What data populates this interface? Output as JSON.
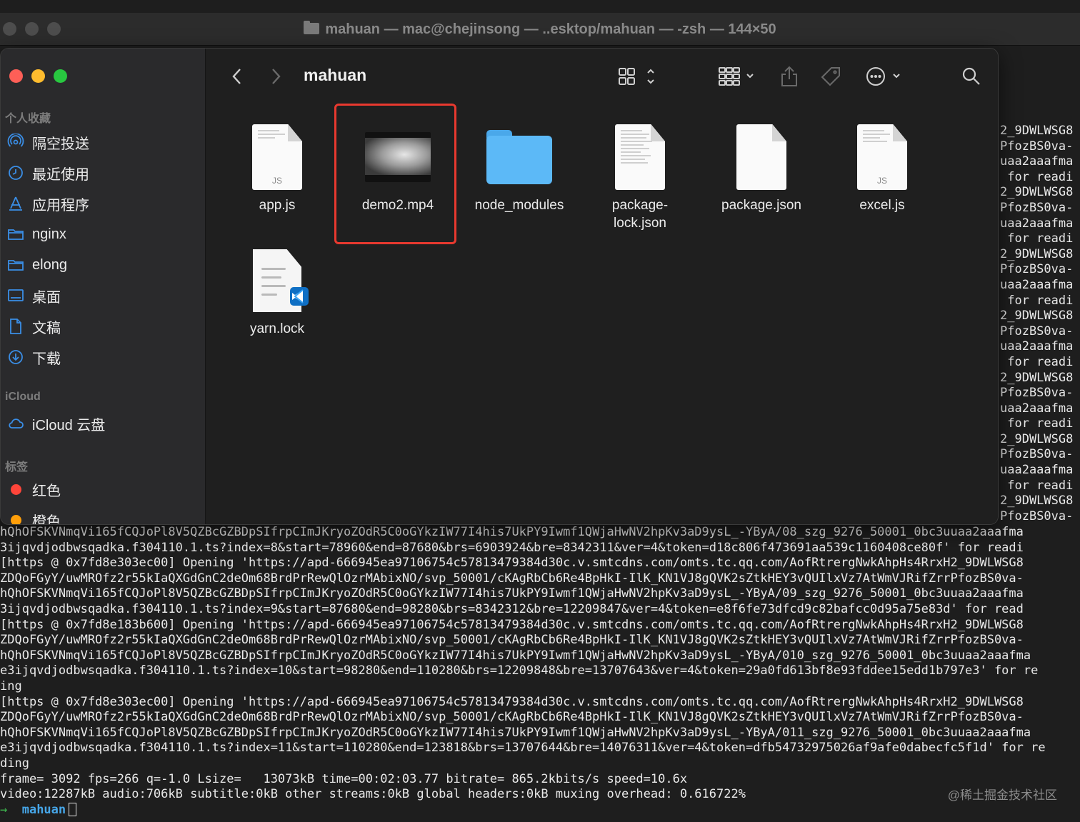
{
  "terminal": {
    "title_parts": "mahuan — mac@chejinsong — ..esktop/mahuan — -zsh — 144×50",
    "right_column": [
      "2_9DWLWSG8",
      "PfozBS0va-",
      "uaa2aaafma",
      " for readi",
      "2_9DWLWSG8",
      "PfozBS0va-",
      "uaa2aaafma",
      " for readi",
      "2_9DWLWSG8",
      "PfozBS0va-",
      "uaa2aaafma",
      " for readi",
      "2_9DWLWSG8",
      "PfozBS0va-",
      "uaa2aaafma",
      " for readi",
      "2_9DWLWSG8",
      "PfozBS0va-",
      "uaa2aaafma",
      " for readi",
      "2_9DWLWSG8",
      "PfozBS0va-",
      "uaa2aaafma",
      " for readi",
      "2_9DWLWSG8",
      "PfozBS0va-"
    ],
    "lines": [
      "hQhOFSKVNmqVi165fCQJoPl8V5QZBcGZBDpSIfrpCImJKryoZOdR5C0oGYkzIW77I4his7UkPY9Iwmf1QWjaHwNV2hpKv3aD9ysL_-YByA/08_szg_9276_50001_0bc3uuaa2aaafma",
      "3ijqvdjodbwsqadka.f304110.1.ts?index=8&start=78960&end=87680&brs=6903924&bre=8342311&ver=4&token=d18c806f473691aa539c1160408ce80f' for readi",
      "[https @ 0x7fd8e303ec00] Opening 'https://apd-666945ea97106754c57813479384d30c.v.smtcdns.com/omts.tc.qq.com/AofRtrergNwkAhpHs4RrxH2_9DWLWSG8",
      "ZDQoFGyY/uwMROfz2r55kIaQXGdGnC2deOm68BrdPrRewQlOzrMAbixNO/svp_50001/cKAgRbCb6Re4BpHkI-IlK_KN1VJ8gQVK2sZtkHEY3vQUIlxVz7AtWmVJRifZrrPfozBS0va-",
      "hQhOFSKVNmqVi165fCQJoPl8V5QZBcGZBDpSIfrpCImJKryoZOdR5C0oGYkzIW77I4his7UkPY9Iwmf1QWjaHwNV2hpKv3aD9ysL_-YByA/09_szg_9276_50001_0bc3uuaa2aaafma",
      "3ijqvdjodbwsqadka.f304110.1.ts?index=9&start=87680&end=98280&brs=8342312&bre=12209847&ver=4&token=e8f6fe73dfcd9c82bafcc0d95a75e83d' for read",
      "[https @ 0x7fd8e183b600] Opening 'https://apd-666945ea97106754c57813479384d30c.v.smtcdns.com/omts.tc.qq.com/AofRtrergNwkAhpHs4RrxH2_9DWLWSG8",
      "ZDQoFGyY/uwMROfz2r55kIaQXGdGnC2deOm68BrdPrRewQlOzrMAbixNO/svp_50001/cKAgRbCb6Re4BpHkI-IlK_KN1VJ8gQVK2sZtkHEY3vQUIlxVz7AtWmVJRifZrrPfozBS0va-",
      "hQhOFSKVNmqVi165fCQJoPl8V5QZBcGZBDpSIfrpCImJKryoZOdR5C0oGYkzIW77I4his7UkPY9Iwmf1QWjaHwNV2hpKv3aD9ysL_-YByA/010_szg_9276_50001_0bc3uuaa2aaafma",
      "e3ijqvdjodbwsqadka.f304110.1.ts?index=10&start=98280&end=110280&brs=12209848&bre=13707643&ver=4&token=29a0fd613bf8e93fddee15edd1b797e3' for re",
      "ing",
      "[https @ 0x7fd8e303ec00] Opening 'https://apd-666945ea97106754c57813479384d30c.v.smtcdns.com/omts.tc.qq.com/AofRtrergNwkAhpHs4RrxH2_9DWLWSG8",
      "ZDQoFGyY/uwMROfz2r55kIaQXGdGnC2deOm68BrdPrRewQlOzrMAbixNO/svp_50001/cKAgRbCb6Re4BpHkI-IlK_KN1VJ8gQVK2sZtkHEY3vQUIlxVz7AtWmVJRifZrrPfozBS0va-",
      "hQhOFSKVNmqVi165fCQJoPl8V5QZBcGZBDpSIfrpCImJKryoZOdR5C0oGYkzIW77I4his7UkPY9Iwmf1QWjaHwNV2hpKv3aD9ysL_-YByA/011_szg_9276_50001_0bc3uuaa2aaafma",
      "e3ijqvdjodbwsqadka.f304110.1.ts?index=11&start=110280&end=123818&brs=13707644&bre=14076311&ver=4&token=dfb54732975026af9afe0dabecfc5f1d' for re",
      "ding",
      "frame= 3092 fps=266 q=-1.0 Lsize=   13073kB time=00:02:03.77 bitrate= 865.2kbits/s speed=10.6x",
      "video:12287kB audio:706kB subtitle:0kB other streams:0kB global headers:0kB muxing overhead: 0.616722%"
    ],
    "prompt_symbol": "→",
    "prompt_dir": "mahuan",
    "watermark": "@稀土掘金技术社区"
  },
  "finder": {
    "folder_title": "mahuan",
    "sidebar": {
      "favorites_header": "个人收藏",
      "favorites": [
        {
          "label": "隔空投送",
          "icon": "airdrop-icon"
        },
        {
          "label": "最近使用",
          "icon": "clock-icon"
        },
        {
          "label": "应用程序",
          "icon": "apps-icon"
        },
        {
          "label": "nginx",
          "icon": "folder-icon"
        },
        {
          "label": "elong",
          "icon": "folder-icon"
        },
        {
          "label": "桌面",
          "icon": "desktop-icon"
        },
        {
          "label": "文稿",
          "icon": "document-icon"
        },
        {
          "label": "下载",
          "icon": "download-icon"
        }
      ],
      "icloud_header": "iCloud",
      "icloud_items": [
        {
          "label": "iCloud 云盘",
          "icon": "cloud-icon"
        }
      ],
      "tags_header": "标签",
      "tags": [
        {
          "label": "红色",
          "color": "#ff453a"
        },
        {
          "label": "橙色",
          "color": "#ff9f0a"
        }
      ]
    },
    "files": [
      {
        "name": "app.js",
        "kind": "js"
      },
      {
        "name": "demo2.mp4",
        "kind": "video",
        "selected": true
      },
      {
        "name": "node_modules",
        "kind": "folder"
      },
      {
        "name": "package-\nlock.json",
        "kind": "doc-lines"
      },
      {
        "name": "package.json",
        "kind": "doc-blank"
      },
      {
        "name": "excel.js",
        "kind": "js"
      },
      {
        "name": "yarn.lock",
        "kind": "yarn"
      }
    ],
    "colors": {
      "selection": "#e8392f",
      "folder": "#5cb9f7",
      "accent": "#3a8ee6"
    }
  }
}
